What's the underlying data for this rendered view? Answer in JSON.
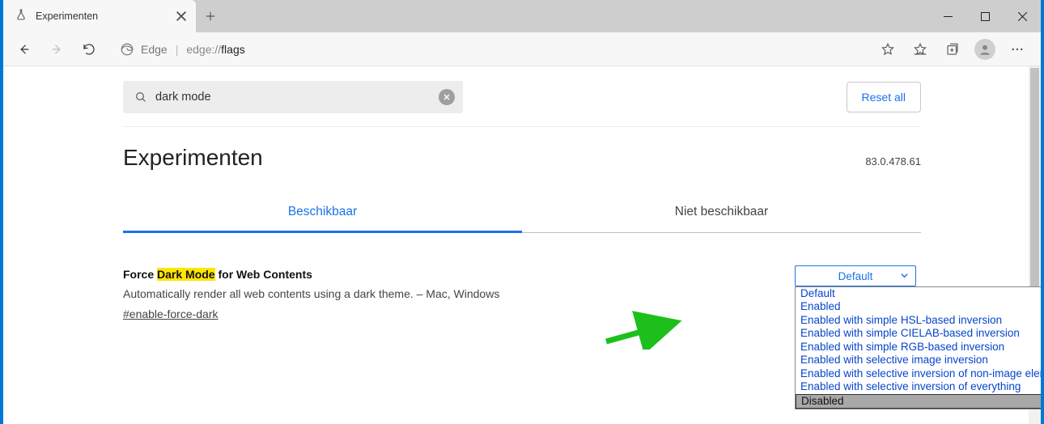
{
  "tab": {
    "title": "Experimenten"
  },
  "address": {
    "label": "Edge",
    "url_prefix": "edge://",
    "url_bold": "flags"
  },
  "search": {
    "value": "dark mode"
  },
  "reset_label": "Reset all",
  "heading": "Experimenten",
  "version": "83.0.478.61",
  "tabs": {
    "available": "Beschikbaar",
    "unavailable": "Niet beschikbaar"
  },
  "flag": {
    "title_pre": "Force ",
    "title_hl": "Dark Mode",
    "title_post": " for Web Contents",
    "desc": "Automatically render all web contents using a dark theme. – Mac, Windows",
    "link": "#enable-force-dark"
  },
  "select": {
    "current": "Default",
    "options": [
      "Default",
      "Enabled",
      "Enabled with simple HSL-based inversion",
      "Enabled with simple CIELAB-based inversion",
      "Enabled with simple RGB-based inversion",
      "Enabled with selective image inversion",
      "Enabled with selective inversion of non-image elements",
      "Enabled with selective inversion of everything",
      "Disabled"
    ]
  }
}
